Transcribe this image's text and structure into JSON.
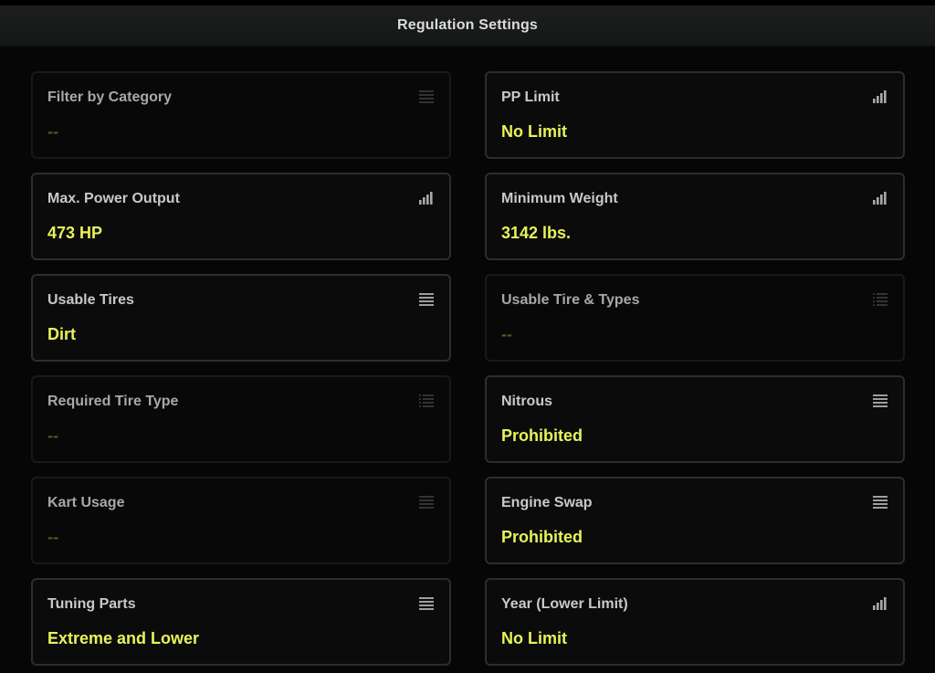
{
  "header": {
    "title": "Regulation Settings"
  },
  "settings": {
    "filter_by_category": {
      "label": "Filter by Category",
      "value": "--",
      "icon": "list-icon"
    },
    "pp_limit": {
      "label": "PP Limit",
      "value": "No Limit",
      "icon": "signal-bars-icon"
    },
    "max_power_output": {
      "label": "Max. Power Output",
      "value": "473 HP",
      "icon": "signal-bars-icon"
    },
    "minimum_weight": {
      "label": "Minimum Weight",
      "value": "3142 lbs.",
      "icon": "signal-bars-icon"
    },
    "usable_tires": {
      "label": "Usable Tires",
      "value": "Dirt",
      "icon": "list-icon"
    },
    "usable_tire_types": {
      "label": "Usable Tire & Types",
      "value": "--",
      "icon": "list-icon"
    },
    "required_tire_type": {
      "label": "Required Tire Type",
      "value": "--",
      "icon": "list-icon"
    },
    "nitrous": {
      "label": "Nitrous",
      "value": "Prohibited",
      "icon": "list-icon"
    },
    "kart_usage": {
      "label": "Kart Usage",
      "value": "--",
      "icon": "list-icon"
    },
    "engine_swap": {
      "label": "Engine Swap",
      "value": "Prohibited",
      "icon": "list-icon"
    },
    "tuning_parts": {
      "label": "Tuning Parts",
      "value": "Extreme and Lower",
      "icon": "list-icon"
    },
    "year_lower_limit": {
      "label": "Year (Lower Limit)",
      "value": "No Limit",
      "icon": "signal-bars-icon"
    }
  },
  "colors": {
    "background": "#060606",
    "value_active": "#e7f35a",
    "value_inactive": "#4f5a1e",
    "label": "#c9c9c9",
    "card_border": "#2c2d2d"
  }
}
